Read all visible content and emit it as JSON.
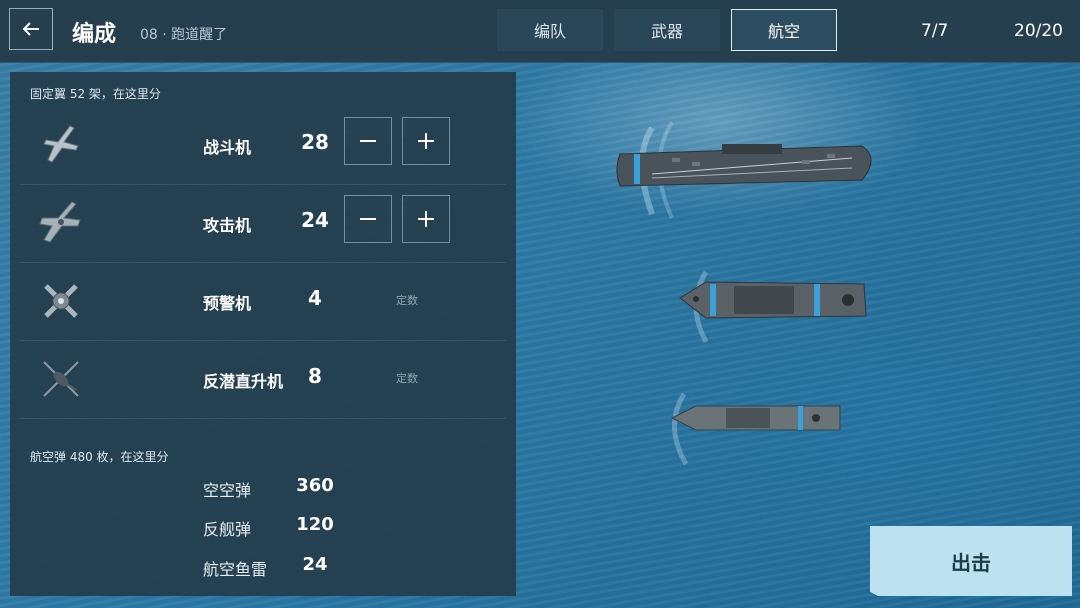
{
  "header": {
    "title": "编成",
    "subtitle": "08 · 跑道醒了",
    "tabs": [
      {
        "label": "编队",
        "active": false
      },
      {
        "label": "武器",
        "active": false
      },
      {
        "label": "航空",
        "active": true
      }
    ],
    "counter_ships": "7/7",
    "counter_slots": "20/20"
  },
  "aircraft": {
    "section_label": "固定翼 52 架，在这里分",
    "rows": [
      {
        "icon": "fighter-jet-icon",
        "name": "战斗机",
        "count": "28",
        "adjustable": true
      },
      {
        "icon": "attack-jet-icon",
        "name": "攻击机",
        "count": "24",
        "adjustable": true
      },
      {
        "icon": "awacs-plane-icon",
        "name": "预警机",
        "count": "4",
        "adjustable": false,
        "fixed_label": "定数"
      },
      {
        "icon": "helicopter-icon",
        "name": "反潜直升机",
        "count": "8",
        "adjustable": false,
        "fixed_label": "定数"
      }
    ]
  },
  "munitions": {
    "section_label": "航空弹 480 枚，在这里分",
    "rows": [
      {
        "name": "空空弹",
        "value": "360"
      },
      {
        "name": "反舰弹",
        "value": "120"
      },
      {
        "name": "航空鱼雷",
        "value": "24"
      }
    ]
  },
  "actions": {
    "sortie_label": "出击"
  },
  "colors": {
    "panel": "#243e4e",
    "topbar": "#253f4f",
    "sortie": "#bde2ef",
    "sea": "#2e7aa6"
  }
}
